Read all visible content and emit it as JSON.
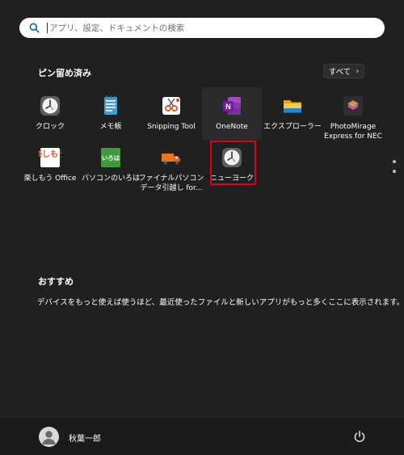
{
  "search": {
    "placeholder": "アプリ、設定、ドキュメントの検索"
  },
  "pinned": {
    "title": "ピン留め済み",
    "all_apps_label": "すべて",
    "apps": [
      {
        "label": "クロック",
        "icon": "clock-icon"
      },
      {
        "label": "メモ帳",
        "icon": "notepad-icon"
      },
      {
        "label": "Snipping Tool",
        "icon": "scissors-icon"
      },
      {
        "label": "OneNote",
        "icon": "onenote-icon"
      },
      {
        "label": "エクスプローラー",
        "icon": "folder-icon"
      },
      {
        "label": "PhotoMirage Express for NEC",
        "icon": "photomirage-icon"
      },
      {
        "label": "楽しもう Office",
        "icon": "tanoshimou-office-icon",
        "icon_text": "楽しもう"
      },
      {
        "label": "パソコンのいろは",
        "icon": "iroha-icon",
        "icon_text": "いろは"
      },
      {
        "label": "ファイナルパソコン データ引越し for...",
        "icon": "moving-truck-icon"
      },
      {
        "label": "ニューヨーク",
        "icon": "clock-icon"
      }
    ]
  },
  "recommended": {
    "title": "おすすめ",
    "empty_text": "デバイスをもっと使えば使うほど、最近使ったファイルと新しいアプリがもっと多くここに表示されます。"
  },
  "user": {
    "name": "秋葉一郎"
  },
  "colors": {
    "highlight": "#e0001a",
    "background": "#202020",
    "search_bg": "#ffffff"
  }
}
